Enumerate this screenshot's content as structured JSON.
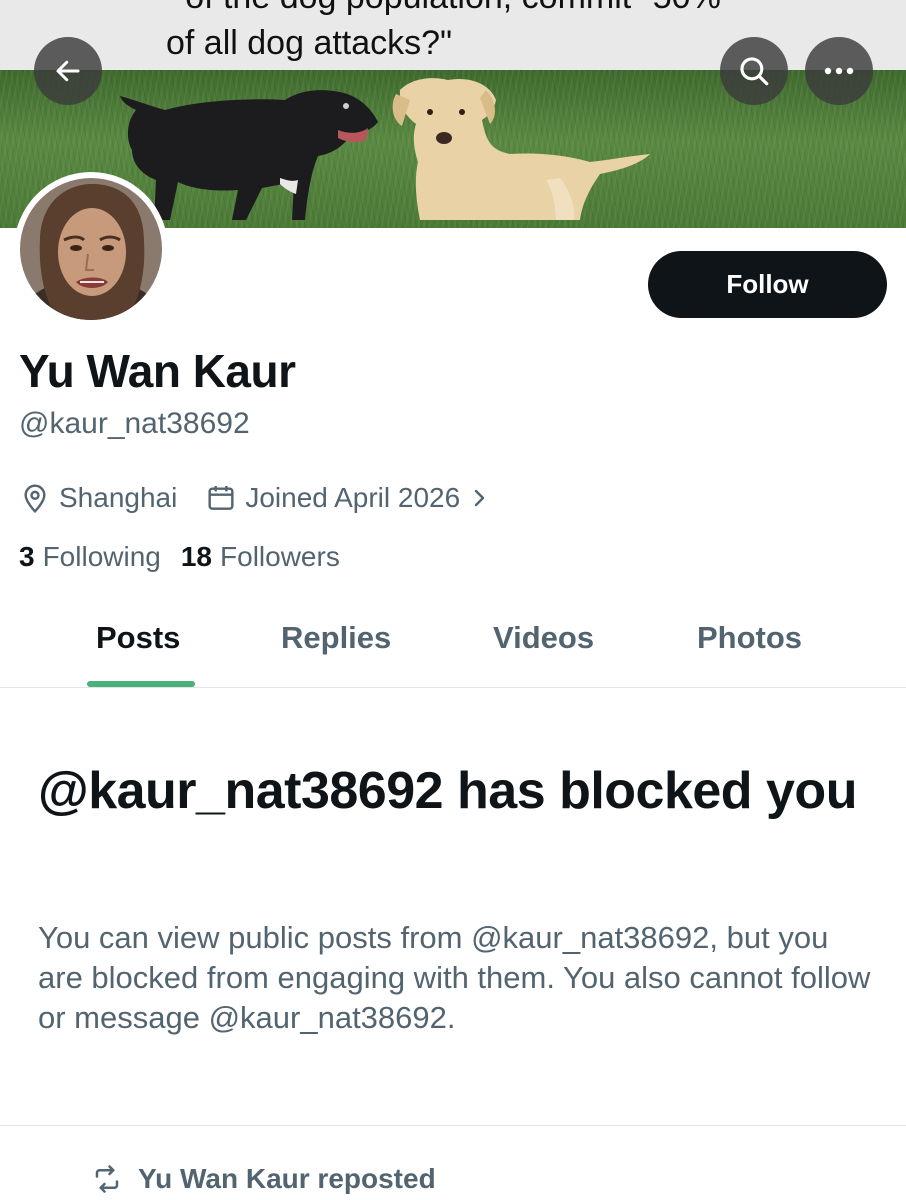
{
  "banner": {
    "caption_line1": "of the dog population, commit \"50%",
    "caption_line2": "of all dog attacks?\""
  },
  "header": {
    "back_icon": "arrow-left-icon",
    "search_icon": "search-icon",
    "more_icon": "more-horizontal-icon"
  },
  "profile": {
    "display_name": "Yu Wan Kaur",
    "handle": "@kaur_nat38692",
    "location": "Shanghai",
    "joined": "Joined April 2026",
    "following_count": "3",
    "following_label": "Following",
    "followers_count": "18",
    "followers_label": "Followers",
    "follow_button": "Follow"
  },
  "tabs": [
    {
      "label": "Posts",
      "active": true
    },
    {
      "label": "Replies",
      "active": false
    },
    {
      "label": "Videos",
      "active": false
    },
    {
      "label": "Photos",
      "active": false
    }
  ],
  "blocked": {
    "title": "@kaur_nat38692 has blocked you",
    "body": "You can view public posts from @kaur_nat38692, but you are blocked from engaging with them. You also cannot follow or message @kaur_nat38692."
  },
  "feed": {
    "repost_label": "Yu Wan Kaur reposted"
  },
  "colors": {
    "accent_tab": "#4bb07a",
    "text_primary": "#0f1419",
    "text_secondary": "#536471",
    "follow_bg": "#0f1419"
  }
}
